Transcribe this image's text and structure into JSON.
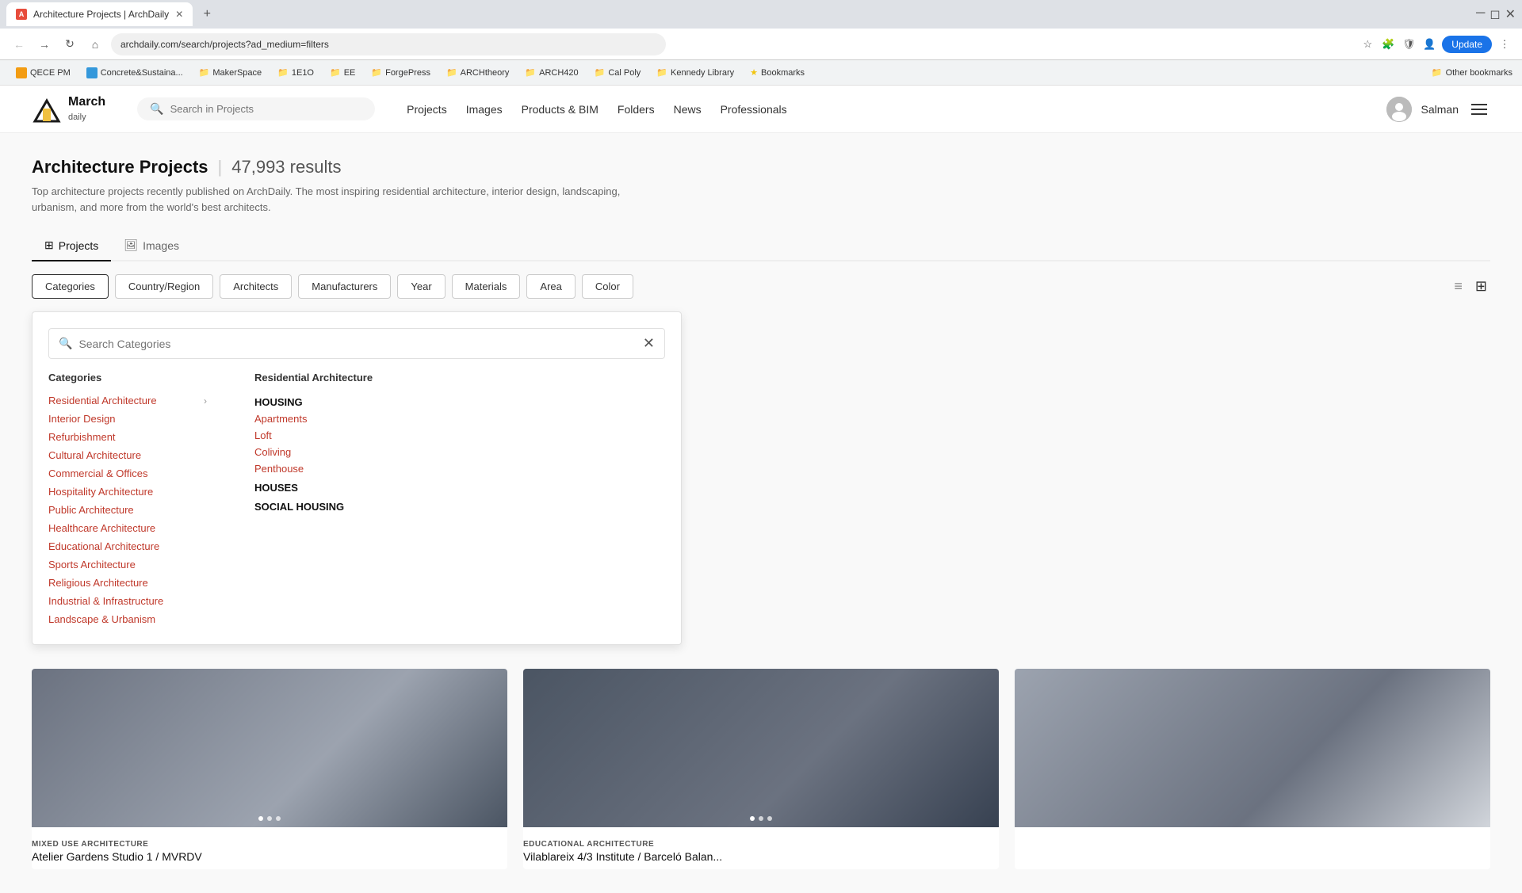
{
  "browser": {
    "tab_title": "Architecture Projects | ArchDaily",
    "tab_favicon": "AD",
    "address": "archdaily.com/search/projects?ad_medium=filters",
    "new_tab_label": "+",
    "bookmarks": [
      {
        "label": "QECE PM",
        "type": "orange",
        "has_icon": true
      },
      {
        "label": "Concrete&Sustaina...",
        "type": "blue",
        "has_icon": true
      },
      {
        "label": "MakerSpace",
        "type": "folder"
      },
      {
        "label": "1E1O",
        "type": "folder"
      },
      {
        "label": "EE",
        "type": "folder"
      },
      {
        "label": "ForgePress",
        "type": "folder"
      },
      {
        "label": "ARCHtheory",
        "type": "folder"
      },
      {
        "label": "ARCH420",
        "type": "folder"
      },
      {
        "label": "Cal Poly",
        "type": "folder"
      },
      {
        "label": "Kennedy Library",
        "type": "folder"
      },
      {
        "label": "Bookmarks",
        "type": "star"
      }
    ],
    "other_bookmarks": "Other bookmarks",
    "update_btn": "Update"
  },
  "navbar": {
    "logo_text": "March daily",
    "search_placeholder": "Search in Projects",
    "links": [
      {
        "label": "Projects",
        "key": "projects"
      },
      {
        "label": "Images",
        "key": "images"
      },
      {
        "label": "Products & BIM",
        "key": "products-bim"
      },
      {
        "label": "Folders",
        "key": "folders"
      },
      {
        "label": "News",
        "key": "news"
      },
      {
        "label": "Professionals",
        "key": "professionals"
      }
    ],
    "user_name": "Salman"
  },
  "page": {
    "title": "Architecture Projects",
    "separator": "|",
    "results_count": "47,993 results",
    "description": "Top architecture projects recently published on ArchDaily. The most inspiring residential architecture, interior design, landscaping, urbanism, and more from the world's best architects."
  },
  "tabs": [
    {
      "label": "Projects",
      "key": "projects",
      "active": true
    },
    {
      "label": "Images",
      "key": "images",
      "active": false
    }
  ],
  "filters": [
    {
      "label": "Categories",
      "key": "categories",
      "active": true
    },
    {
      "label": "Country/Region",
      "key": "country"
    },
    {
      "label": "Architects",
      "key": "architects"
    },
    {
      "label": "Manufacturers",
      "key": "manufacturers"
    },
    {
      "label": "Year",
      "key": "year"
    },
    {
      "label": "Materials",
      "key": "materials"
    },
    {
      "label": "Area",
      "key": "area"
    },
    {
      "label": "Color",
      "key": "color"
    }
  ],
  "categories_dropdown": {
    "search_placeholder": "Search Categories",
    "col1_header": "Categories",
    "col1_items": [
      {
        "label": "Residential Architecture",
        "has_arrow": true
      },
      {
        "label": "Interior Design",
        "has_arrow": false
      },
      {
        "label": "Refurbishment",
        "has_arrow": false
      },
      {
        "label": "Cultural Architecture",
        "has_arrow": false
      },
      {
        "label": "Commercial & Offices",
        "has_arrow": false
      },
      {
        "label": "Hospitality Architecture",
        "has_arrow": false
      },
      {
        "label": "Public Architecture",
        "has_arrow": false
      },
      {
        "label": "Healthcare Architecture",
        "has_arrow": false
      },
      {
        "label": "Educational Architecture",
        "has_arrow": false
      },
      {
        "label": "Sports Architecture",
        "has_arrow": false
      },
      {
        "label": "Religious Architecture",
        "has_arrow": false
      },
      {
        "label": "Industrial & Infrastructure",
        "has_arrow": false
      },
      {
        "label": "Landscape & Urbanism",
        "has_arrow": false
      }
    ],
    "col2_header": "Residential Architecture",
    "col2_items": [
      {
        "label": "HOUSING",
        "type": "header"
      },
      {
        "label": "Apartments",
        "type": "link"
      },
      {
        "label": "Loft",
        "type": "link"
      },
      {
        "label": "Coliving",
        "type": "link"
      },
      {
        "label": "Penthouse",
        "type": "link"
      },
      {
        "label": "HOUSES",
        "type": "header"
      },
      {
        "label": "SOCIAL HOUSING",
        "type": "header"
      }
    ]
  },
  "project_cards": [
    {
      "tag": "MIXED USE ARCHITECTURE",
      "title": "Atelier Gardens Studio 1 / MVRDV",
      "img_color": "#6b7280",
      "dots": [
        true,
        false,
        false
      ]
    },
    {
      "tag": "EDUCATIONAL ARCHITECTURE",
      "title": "Vilablareix 4/3 Institute / Barceló Balan...",
      "img_color": "#4b5563",
      "dots": [
        true,
        false,
        false
      ]
    },
    {
      "tag": "",
      "title": "",
      "img_color": "#9ca3af",
      "dots": []
    },
    {
      "tag": "",
      "title": "",
      "img_color": "#6b7280",
      "dots": []
    },
    {
      "tag": "",
      "title": "",
      "img_color": "#4b5563",
      "dots": []
    }
  ],
  "colors": {
    "brand_red": "#c0392b",
    "nav_border": "#eee",
    "accent_blue": "#1a73e8"
  }
}
